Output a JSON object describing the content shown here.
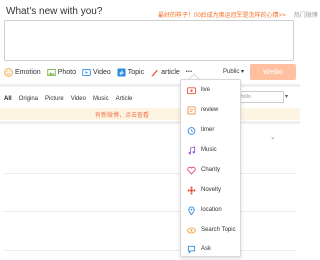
{
  "composer": {
    "title": "What's new with you?",
    "hint": "最好的样子！00后成为奥运冠军是怎样的心情>>",
    "hot_topics": "热门微博",
    "textarea_value": ""
  },
  "toolbar": {
    "items": [
      {
        "label": "Emotion",
        "icon": "emotion-icon"
      },
      {
        "label": "Photo",
        "icon": "photo-icon"
      },
      {
        "label": "Video",
        "icon": "video-icon"
      },
      {
        "label": "Topic",
        "icon": "topic-icon"
      },
      {
        "label": "article",
        "icon": "article-icon"
      }
    ],
    "more": "•••",
    "visibility": "Public ▾",
    "publish": "Weibo"
  },
  "feed_tabs": {
    "items": [
      "All",
      "Origina",
      "Picture",
      "Video",
      "Music",
      "Article"
    ],
    "active": "All",
    "search_placeholder": "eibos of follo",
    "search_arrow": "▾"
  },
  "banner": {
    "text": "有新微博，点击查看"
  },
  "more_menu": {
    "items": [
      {
        "label": "live",
        "icon": "live-icon",
        "color": "#e8553a"
      },
      {
        "label": "review",
        "icon": "review-icon",
        "color": "#f08c3c"
      },
      {
        "label": "timer",
        "icon": "timer-icon",
        "color": "#2d8ce0"
      },
      {
        "label": "Music",
        "icon": "music-icon",
        "color": "#9a5cd6"
      },
      {
        "label": "Charity",
        "icon": "charity-icon",
        "color": "#e84a6a"
      },
      {
        "label": "Novelty",
        "icon": "novelty-icon",
        "color": "#e8553a"
      },
      {
        "label": "location",
        "icon": "location-icon",
        "color": "#2d8ce0"
      },
      {
        "label": "Search Topic",
        "icon": "search-topic-icon",
        "color": "#f0a030"
      },
      {
        "label": "Ask",
        "icon": "ask-icon",
        "color": "#2d8ce0"
      }
    ]
  },
  "colors": {
    "accent": "#f56c20",
    "publish_button": "#ffc09f",
    "banner_bg": "#fdf5e1",
    "banner_text": "#eb7350"
  }
}
